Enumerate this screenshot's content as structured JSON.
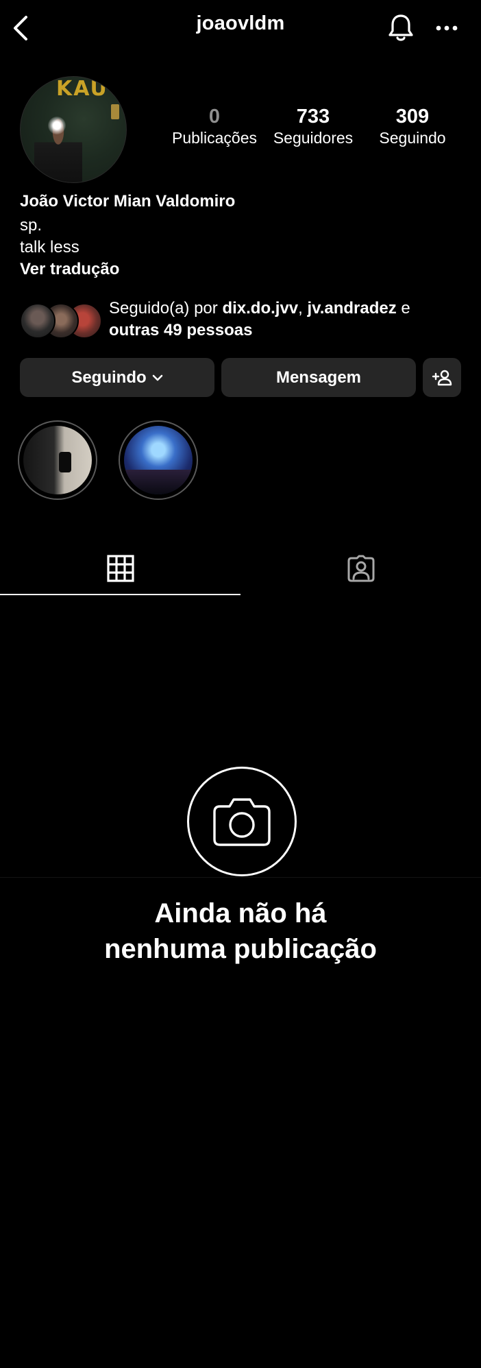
{
  "header": {
    "username": "joaovldm",
    "back_icon": "chevron-left-icon",
    "notifications_icon": "bell-icon",
    "more_icon": "more-horizontal-icon"
  },
  "profile": {
    "stats": [
      {
        "value": "0",
        "label": "Publicações"
      },
      {
        "value": "733",
        "label": "Seguidores"
      },
      {
        "value": "309",
        "label": "Seguindo"
      }
    ],
    "avatar_sign_text": "KAU",
    "name": "João Victor Mian Valdomiro",
    "bio_lines": [
      "sp.",
      "talk less"
    ],
    "translate_label": "Ver tradução"
  },
  "followed_by": {
    "prefix": "Seguido(a) por ",
    "user1": "dix.do.jvv",
    "separator": ", ",
    "user2": "jv.andradez",
    "conjunction": " e",
    "others": "outras 49 pessoas"
  },
  "actions": {
    "following_label": "Seguindo",
    "message_label": "Mensagem",
    "add_user_icon": "add-user-icon"
  },
  "tabs": [
    {
      "name": "posts-grid",
      "icon": "grid-icon",
      "active": true
    },
    {
      "name": "tagged",
      "icon": "tagged-person-icon",
      "active": false
    }
  ],
  "empty_state": {
    "icon": "camera-icon",
    "title_line1": "Ainda não há",
    "title_line2": "nenhuma publicação"
  },
  "colors": {
    "background": "#000000",
    "button_bg": "#262626",
    "text": "#ffffff",
    "muted": "#8e8e8e"
  }
}
